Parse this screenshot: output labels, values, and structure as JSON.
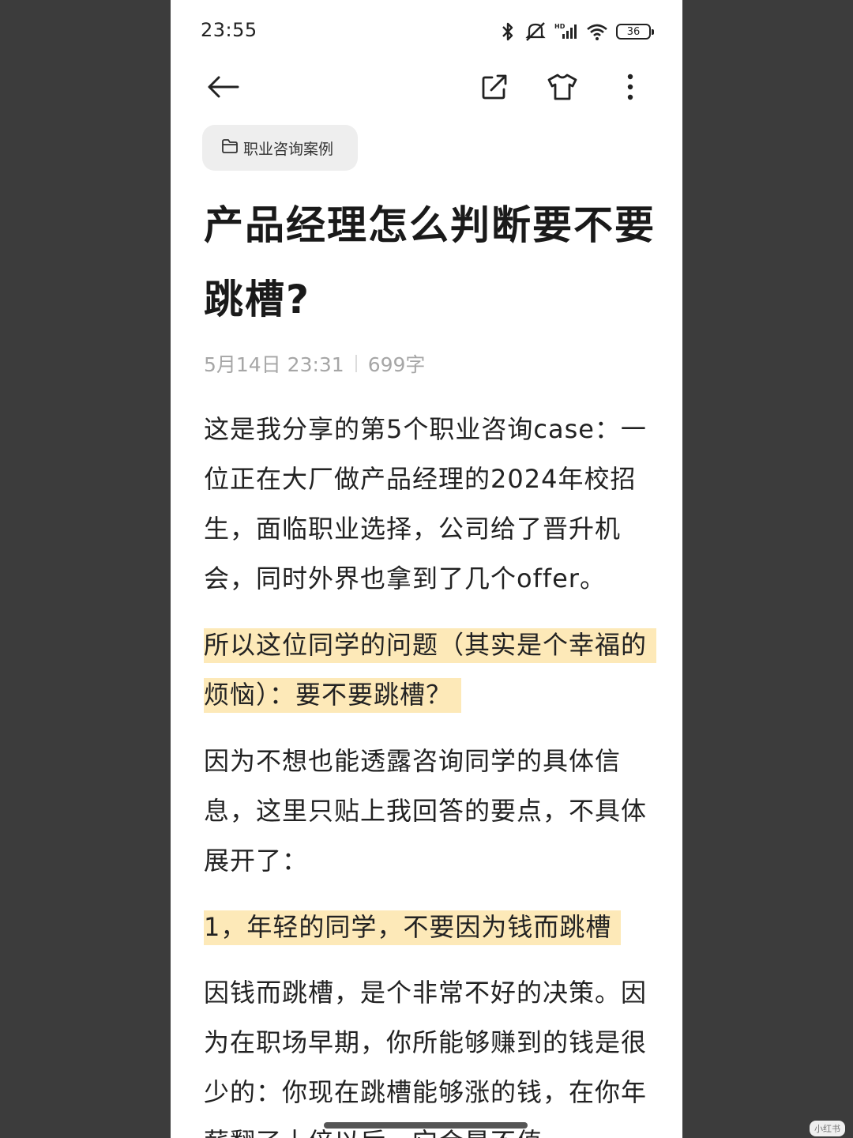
{
  "status_bar": {
    "time": "23:55",
    "battery": "36",
    "icons": [
      "bluetooth-icon",
      "mute-icon",
      "hd-signal-icon",
      "wifi-icon",
      "battery-icon"
    ]
  },
  "toolbar": {
    "icons": [
      "back-arrow-icon",
      "share-icon",
      "tshirt-icon",
      "more-vertical-icon"
    ]
  },
  "folder": {
    "label": "职业咨询案例",
    "icon": "folder-icon"
  },
  "article": {
    "title": "产品经理怎么判断要不要跳槽?",
    "date": "5月14日 23:31",
    "word_count": "699字",
    "p1": "这是我分享的第5个职业咨询case：一位正在大厂做产品经理的2024年校招生，面临职业选择，公司给了晋升机会，同时外界也拿到了几个offer。",
    "p2": "所以这位同学的问题（其实是个幸福的烦恼）：要不要跳槽？",
    "p3": "因为不想也能透露咨询同学的具体信息，这里只贴上我回答的要点，不具体展开了：",
    "p4": "1，年轻的同学，不要因为钱而跳槽",
    "p5": "因钱而跳槽，是个非常不好的决策。因为在职场早期，你所能够赚到的钱是很少的：你现在跳槽能够涨的钱，在你年薪翻了十倍以后，它会是不值"
  },
  "watermark": "小红书"
}
